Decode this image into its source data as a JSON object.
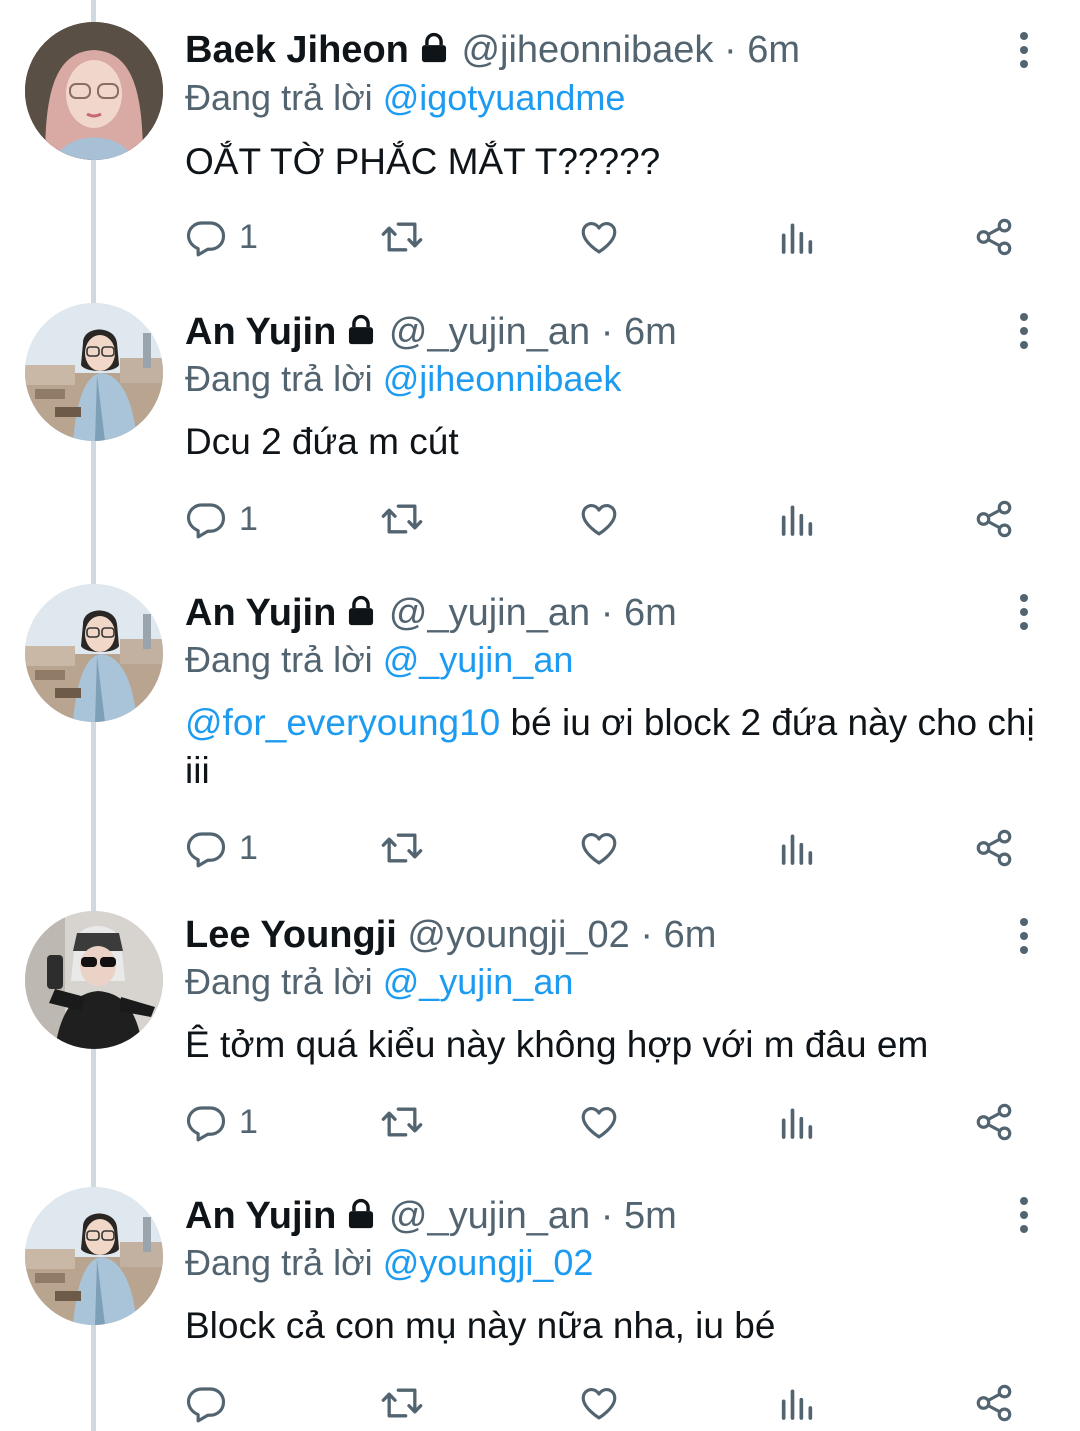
{
  "labels": {
    "replying_prefix": "Đang trả lời",
    "dot": "·"
  },
  "colors": {
    "mention": "#1d9bf0",
    "secondary_text": "#536471",
    "thread_line": "#cfd9de"
  },
  "tweets": [
    {
      "name": "Baek Jiheon",
      "locked": true,
      "handle": "@jiheonnibaek",
      "time": "6m",
      "reply_to": "@igotyuandme",
      "mention": "",
      "text": "OẮT TỜ PHẮC MẮT T?????",
      "reply_count": "1",
      "avatar_icon": "avatar-pink-hair"
    },
    {
      "name": "An Yujin",
      "locked": true,
      "handle": "@_yujin_an",
      "time": "6m",
      "reply_to": "@jiheonnibaek",
      "mention": "",
      "text": "Dcu 2 đứa m cút",
      "reply_count": "1",
      "avatar_icon": "avatar-city-view"
    },
    {
      "name": "An Yujin",
      "locked": true,
      "handle": "@_yujin_an",
      "time": "6m",
      "reply_to": "@_yujin_an",
      "mention": "@for_everyoung10",
      "text": " bé iu ơi block 2 đứa này cho chị iii",
      "reply_count": "1",
      "avatar_icon": "avatar-city-view"
    },
    {
      "name": "Lee Youngji",
      "locked": false,
      "handle": "@youngji_02",
      "time": "6m",
      "reply_to": "@_yujin_an",
      "mention": "",
      "text": "Ê tởm quá kiểu này không hợp với m đâu em",
      "reply_count": "1",
      "avatar_icon": "avatar-mirror-selfie"
    },
    {
      "name": "An Yujin",
      "locked": true,
      "handle": "@_yujin_an",
      "time": "5m",
      "reply_to": "@youngji_02",
      "mention": "",
      "text": "Block cả con mụ này nữa nha, iu bé",
      "reply_count": "",
      "avatar_icon": "avatar-city-view"
    }
  ]
}
